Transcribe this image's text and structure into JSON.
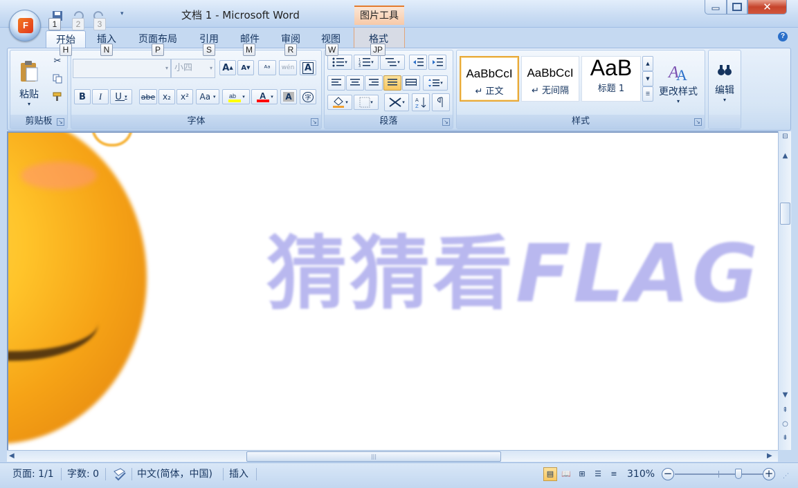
{
  "app": {
    "window_title": "文档 1 - Microsoft Word",
    "contextual_title": "图片工具",
    "office_logo": "F",
    "qat_keytips": [
      "1",
      "2",
      "3"
    ]
  },
  "tabs": [
    {
      "label": "开始",
      "keytip": "H"
    },
    {
      "label": "插入",
      "keytip": "N"
    },
    {
      "label": "页面布局",
      "keytip": "P"
    },
    {
      "label": "引用",
      "keytip": "S"
    },
    {
      "label": "邮件",
      "keytip": "M"
    },
    {
      "label": "审阅",
      "keytip": "R"
    },
    {
      "label": "视图",
      "keytip": "W"
    },
    {
      "label": "格式",
      "keytip": "JP"
    }
  ],
  "ribbon": {
    "clipboard": {
      "label": "剪贴板",
      "paste_label": "粘贴"
    },
    "font": {
      "label": "字体",
      "font_name": "",
      "font_size": "小四",
      "bold": "B",
      "italic": "I",
      "underline": "U",
      "strike": "abe",
      "subscript": "x₂",
      "superscript": "x²",
      "change_case": "Aa",
      "grow": "A",
      "shrink": "A",
      "font_color": "A",
      "shading": "A",
      "phonetic": "wén",
      "char_border": "A",
      "enclose": "字"
    },
    "paragraph": {
      "label": "段落"
    },
    "styles": {
      "label": "样式",
      "cards": [
        {
          "sample": "AaBbCcI",
          "name": "↵ 正文"
        },
        {
          "sample": "AaBbCcI",
          "name": "↵ 无间隔"
        },
        {
          "sample": "AaB",
          "name": "标题 1"
        }
      ],
      "change_styles": "更改样式"
    },
    "editing": {
      "label": "编辑"
    }
  },
  "document": {
    "watermark_cn": "猜猜看",
    "watermark_latin": "FLAG"
  },
  "status": {
    "page": "页面: 1/1",
    "words": "字数: 0",
    "language": "中文(简体，中国)",
    "mode": "插入",
    "zoom": "310%",
    "zoom_minus": "−",
    "zoom_plus": "+"
  },
  "colors": {
    "highlight": "#ffff00",
    "font_color": "#ff0000",
    "accent_orange": "#e37b2e"
  }
}
